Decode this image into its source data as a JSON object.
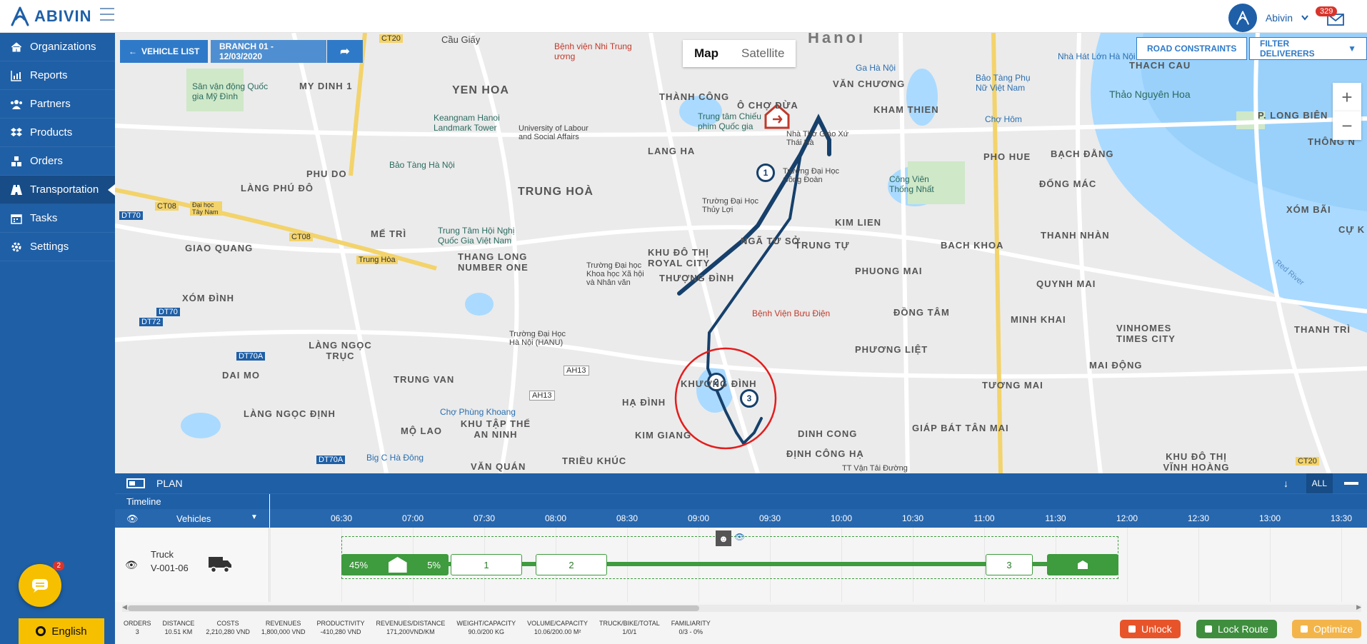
{
  "brand": {
    "name": "ABIVIN"
  },
  "user": {
    "name": "Abivin",
    "notifications": "329"
  },
  "sidebar": {
    "items": [
      {
        "label": "Organizations",
        "icon": "home-icon"
      },
      {
        "label": "Reports",
        "icon": "bar-chart-icon"
      },
      {
        "label": "Partners",
        "icon": "users-icon"
      },
      {
        "label": "Products",
        "icon": "dropbox-icon"
      },
      {
        "label": "Orders",
        "icon": "cubes-icon"
      },
      {
        "label": "Transportation",
        "icon": "road-icon",
        "active": true
      },
      {
        "label": "Tasks",
        "icon": "calendar-icon"
      },
      {
        "label": "Settings",
        "icon": "gear-icon"
      }
    ],
    "chat_badge": "2",
    "language": "English"
  },
  "map": {
    "vehicle_list_label": "VEHICLE LIST",
    "branch_label": "BRANCH 01 - 12/03/2020",
    "toggle": {
      "map": "Map",
      "satellite": "Satellite"
    },
    "road_constraints_label": "ROAD CONSTRAINTS",
    "filter_deliverers_label": "FILTER DELIVERERS",
    "zoom_in": "+",
    "zoom_out": "−",
    "stops": [
      "1",
      "2",
      "3"
    ],
    "labels": {
      "hanoi": "Hanoi",
      "cau_giay": "Cầu Giấy",
      "benh_vien_nhi": "Bệnh viện Nhi Trung ương",
      "yen_hoa": "YEN HOA",
      "my_dinh1": "MY DINH 1",
      "san_van_dong": "Sân vận động Quốc gia Mỹ Đình",
      "thanh_cong": "THÀNH CÔNG",
      "o_cho_dua": "Ô CHỢ DỪA",
      "van_chuong": "VĂN CHƯƠNG",
      "kham_thien": "KHAM THIEN",
      "ga_ha_noi": "Ga Hà Nội",
      "bao_tang_phu_nu": "Bảo Tàng Phụ Nữ Việt Nam",
      "nha_hat_lon": "Nhà Hát Lớn Hà Nội",
      "thach_cau": "THACH CAU",
      "thao_nguyen_hoa": "Thảo Nguyên Hoa",
      "p_long_bien": "P. LONG BIÊN",
      "keangnam": "Keangnam Hanoi Landmark Tower",
      "university": "University of Labour and Social Affairs",
      "trung_tam_chieu_phim": "Trung tâm Chiếu phim Quốc gia",
      "nha_tho": "Nhà Thờ Giáo Xứ Thái Hà",
      "lang_ha": "LANG HA",
      "cho_hom": "Chợ Hôm",
      "phu_do": "PHU DO",
      "bao_tang_ha_noi": "Bảo Tàng Hà Nội",
      "trung_hoa": "TRUNG HOÀ",
      "truong_dai_hoc_cong_doan": "Trường Đại Học Công Đoàn",
      "cong_vien_thong_nhat": "Công Viên Thống Nhất",
      "pho_hue": "PHO HUE",
      "dong_mac": "ĐỐNG MÁC",
      "bach_dang": "BẠCH ĐẰNG",
      "lang_phu_do": "LÀNG PHÚ ĐÔ",
      "truong_dai_hoc_thuy_loi": "Trường Đại Học Thủy Lợi",
      "xom_bai": "XÓM BÃI",
      "trung_tam_hoi_nghi": "Trung Tâm Hội Nghị Quốc Gia Việt Nam",
      "me_tri": "MẾ TRÌ",
      "kim_lien": "KIM LIEN",
      "bach_khoa": "BACH KHOA",
      "thanh_nhan": "THANH NHÀN",
      "giao_quang": "GIAO QUANG",
      "thang_long_number_one": "THANG LONG NUMBER ONE",
      "nga_tu_so": "NGÃ TƯ SỞ",
      "trung_tu": "TRUNG TỰ",
      "khu_do_thi_royal": "KHU ĐÔ THỊ ROYAL CITY",
      "phuong_mai": "PHUONG MAI",
      "quynh_mai": "QUYNH MAI",
      "truong_dai_hoc_khxh": "Trường Đại học Khoa học Xã hội và Nhân văn",
      "thuong_dinh": "THƯỢNG ĐÌNH",
      "xom_dinh": "XÓM ĐÌNH",
      "dong_tam": "ĐỒNG TÂM",
      "minh_khai": "MINH KHAI",
      "vinhomes": "VINHOMES TIMES CITY",
      "thanh_tri": "THANH TRÌ",
      "benh_vien_buu_dien": "Bệnh Viện Bưu Điện",
      "truong_dai_hoc_hanu": "Trường Đại Học Hà Nội (HANU)",
      "phuong_liet": "PHƯƠNG LIỆT",
      "dai_mo": "DAI MO",
      "lang_ngoc_truc": "LÀNG NGỌC TRỤC",
      "trung_van": "TRUNG VAN",
      "khuong_dinh": "KHƯƠNG ĐÌNH",
      "mai_dong": "MAI ĐỘNG",
      "tuong_mai": "TƯƠNG MAI",
      "cho_phung_khoang": "Chợ Phùng Khoang",
      "ha_dinh": "HẠ ĐÌNH",
      "lang_ngoc_dinh": "LÀNG NGỌC ĐỊNH",
      "mo_lao": "MỘ LAO",
      "khu_tap_the_an_ninh": "KHU TẬP THỂ AN NINH",
      "kim_giang": "KIM GIANG",
      "dinh_cong": "DINH CONG",
      "giap_bat_tan_mai": "GIÁP BÁT TÂN MAI",
      "big_c": "Big C Hà Đông",
      "trieu_khuc": "TRIỀU KHÚC",
      "dinh_cong_ha": "ĐỊNH CÔNG HẠ",
      "khu_do_thi_vinh_hoang": "KHU ĐÔ THỊ VĨNH HOÀNG",
      "van_quan": "VĂN QUÁN",
      "red_river": "Red River",
      "cu_khe": "CỰ K",
      "thong_n": "THÔNG N",
      "dai_hoc_tay_nam": "Đại học Tây Nam",
      "trung_hoa_road": "Trung Hòa",
      "tt_van_tai_duong": "TT Vận Tải Đường"
    },
    "road_badges": {
      "ct20": "CT20",
      "ct08a": "CT08",
      "ct08b": "CT08",
      "dt70": "DT70",
      "dt70b": "DT70",
      "dt72": "DT72",
      "dt70a": "DT70A",
      "dt70a2": "DT70A",
      "ah13a": "AH13",
      "ah13b": "AH13",
      "ct20b": "CT20"
    }
  },
  "plan": {
    "title": "PLAN",
    "all_label": "ALL",
    "timeline_label": "Timeline",
    "vehicles_label": "Vehicles",
    "ticks": [
      "06:30",
      "07:00",
      "07:30",
      "08:00",
      "08:30",
      "09:00",
      "09:30",
      "10:00",
      "10:30",
      "11:00",
      "11:30",
      "12:00",
      "12:30",
      "13:00",
      "13:30"
    ],
    "vehicle": {
      "type": "Truck",
      "id": "V-001-06"
    },
    "segments": {
      "start_left": "45%",
      "start_right": "5%",
      "stop1": "1",
      "stop2": "2",
      "stop3": "3"
    }
  },
  "stats": [
    {
      "label": "ORDERS",
      "value": "3"
    },
    {
      "label": "DISTANCE",
      "value": "10.51 KM"
    },
    {
      "label": "COSTS",
      "value": "2,210,280 VND"
    },
    {
      "label": "REVENUES",
      "value": "1,800,000 VND"
    },
    {
      "label": "PRODUCTIVITY",
      "value": "-410,280 VND"
    },
    {
      "label": "REVENUES/DISTANCE",
      "value": "171,200VND/KM"
    },
    {
      "label": "WEIGHT/CAPACITY",
      "value": "90.0/200 KG"
    },
    {
      "label": "VOLUME/CAPACITY",
      "value": "10.06/200.00 M²"
    },
    {
      "label": "TRUCK/BIKE/TOTAL",
      "value": "1/0/1"
    },
    {
      "label": "FAMILIARITY",
      "value": "0/3 - 0%"
    }
  ],
  "actions": {
    "unlock": "Unlock",
    "lock_route": "Lock Route",
    "optimize": "Optimize"
  },
  "colors": {
    "primary": "#1f5fa6",
    "button_blue": "#2f7ac8",
    "route": "#16406b",
    "green": "#3e9b3e",
    "unlock": "#e8542a",
    "optimize": "#f3b54a",
    "chat": "#f6c000"
  }
}
